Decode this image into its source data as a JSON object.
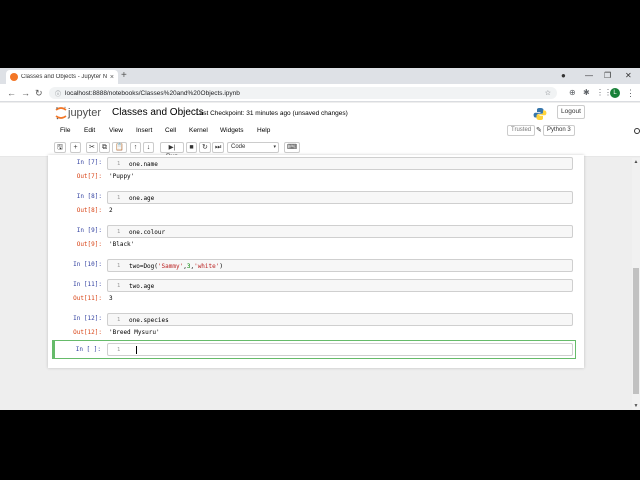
{
  "browser": {
    "tab_title": "Classes and Objects - Jupyter No",
    "tab_close": "×",
    "new_tab": "+",
    "window_controls": {
      "minimize": "—",
      "restore": "❐",
      "close": "✕",
      "account": "●"
    },
    "nav": {
      "back": "←",
      "forward": "→",
      "reload": "↻",
      "home": "⌂"
    },
    "url": "localhost:8888/notebooks/Classes%20and%20Objects.ipynb",
    "lock": "ⓘ",
    "bookmark": "☆",
    "extensions": [
      "⊕",
      "✱",
      "⋮⋮"
    ],
    "profile_initial": "L",
    "menu": "⋮"
  },
  "jupyter": {
    "logo_text": "jupyter",
    "notebook_name": "Classes and Objects",
    "checkpoint": "Last Checkpoint: 31 minutes ago",
    "unsaved": "(unsaved changes)",
    "logout": "Logout",
    "menus": [
      "File",
      "Edit",
      "View",
      "Insert",
      "Cell",
      "Kernel",
      "Widgets",
      "Help"
    ],
    "trusted": "Trusted",
    "kernel_name": "Python 3",
    "toolbar": {
      "save": "🖫",
      "add": "+",
      "cut": "✂",
      "copy": "⧉",
      "paste": "📋",
      "up": "↑",
      "down": "↓",
      "run": "▶| Run",
      "stop": "■",
      "restart": "↻",
      "restart_run": "⏭",
      "cell_type": "Code",
      "cell_type_caret": "▾",
      "keyboard": "⌨"
    }
  },
  "cells": [
    {
      "in_prompt": "In [7]:",
      "line": "1",
      "code": "one.name",
      "out_prompt": "Out[7]:",
      "output": "'Puppy'"
    },
    {
      "in_prompt": "In [8]:",
      "line": "1",
      "code": "one.age",
      "out_prompt": "Out[8]:",
      "output": "2"
    },
    {
      "in_prompt": "In [9]:",
      "line": "1",
      "code": "one.colour",
      "out_prompt": "Out[9]:",
      "output": "'Black'"
    },
    {
      "in_prompt": "In [10]:",
      "line": "1",
      "code_parts": [
        "two=Dog(",
        "'Sammy'",
        ",",
        "3",
        ",",
        "'white'",
        ")"
      ]
    },
    {
      "in_prompt": "In [11]:",
      "line": "1",
      "code": "two.age",
      "out_prompt": "Out[11]:",
      "output": "3"
    },
    {
      "in_prompt": "In [12]:",
      "line": "1",
      "code": "one.species",
      "out_prompt": "Out[12]:",
      "output": "'Breed Mysuru'"
    },
    {
      "in_prompt": "In [ ]:",
      "line": "1",
      "code": ""
    }
  ],
  "scrollbar": {
    "up": "▲",
    "down": "▼"
  }
}
